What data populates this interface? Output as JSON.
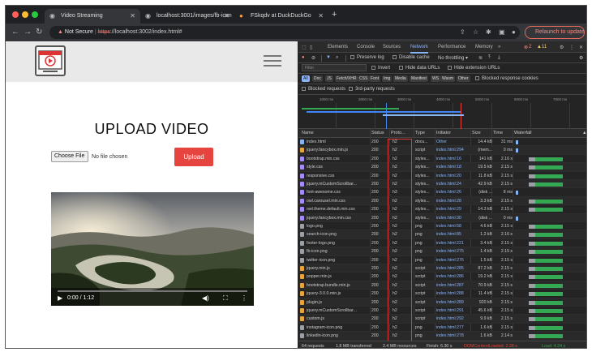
{
  "browser": {
    "tabs": [
      {
        "title": "Video Streaming",
        "active": true
      },
      {
        "title": "localhost:3001/images/fb-icon",
        "active": false
      },
      {
        "title": "FSkqdv at DuckDuckGo",
        "active": false
      }
    ],
    "address": {
      "warning": "Not Secure",
      "scheme": "https",
      "url_rest": "://localhost:3002/index.html#"
    },
    "relaunch_label": "Relaunch to update",
    "colors": {
      "close": "#ff5f57",
      "minimize": "#febc2e",
      "maximize": "#28c840"
    }
  },
  "page": {
    "heading": "UPLOAD VIDEO",
    "choose_file": "Choose File",
    "no_file": "No file chosen",
    "upload": "Upload",
    "video_time": "0:00 / 1:12"
  },
  "devtools": {
    "tabs": [
      "Elements",
      "Console",
      "Sources",
      "Network",
      "Performance",
      "Memory",
      "»"
    ],
    "active_tab": "Network",
    "errors": "2",
    "warnings": "11",
    "toolbar": {
      "preserve_log": "Preserve log",
      "disable_cache": "Disable cache",
      "throttling": "No throttling"
    },
    "filter": {
      "placeholder": "Filter",
      "invert": "Invert",
      "hide_data_urls": "Hide data URLs",
      "hide_ext_urls": "Hide extension URLs"
    },
    "types": [
      "All",
      "Doc",
      "JS",
      "Fetch/XHR",
      "CSS",
      "Font",
      "Img",
      "Media",
      "Manifest",
      "WS",
      "Wasm",
      "Other"
    ],
    "blocked_cookies": "Blocked response cookies",
    "blocked_requests": "Blocked requests",
    "third_party": "3rd-party requests",
    "timeline_ticks": [
      "1000 ms",
      "2000 ms",
      "3000 ms",
      "4000 ms",
      "5000 ms",
      "6000 ms",
      "7000 ms"
    ],
    "columns": [
      "Name",
      "Status",
      "Proto...",
      "Type",
      "Initiator",
      "Size",
      "Time",
      "Waterfall"
    ],
    "requests": [
      {
        "name": "index.html",
        "status": "200",
        "proto": "h2",
        "type": "docu...",
        "initiator": "Other",
        "size": "14.4 kB",
        "time": "31 ms",
        "kind": "doc"
      },
      {
        "name": "jquery.fancybox.min.js",
        "status": "200",
        "proto": "h2",
        "type": "script",
        "initiator": "index.html:294",
        "size": "(mem...",
        "time": "0 ms",
        "kind": "js"
      },
      {
        "name": "bootstrap.min.css",
        "status": "200",
        "proto": "h2",
        "type": "styles...",
        "initiator": "index.html:16",
        "size": "141 kB",
        "time": "2.16 s",
        "kind": "css"
      },
      {
        "name": "style.css",
        "status": "200",
        "proto": "h2",
        "type": "styles...",
        "initiator": "index.html:18",
        "size": "19.5 kB",
        "time": "2.15 s",
        "kind": "css"
      },
      {
        "name": "responsive.css",
        "status": "200",
        "proto": "h2",
        "type": "styles...",
        "initiator": "index.html:20",
        "size": "11.8 kB",
        "time": "2.15 s",
        "kind": "css"
      },
      {
        "name": "jquery.mCustomScrollbar...",
        "status": "200",
        "proto": "h2",
        "type": "styles...",
        "initiator": "index.html:24",
        "size": "42.9 kB",
        "time": "2.15 s",
        "kind": "css"
      },
      {
        "name": "font-awesome.css",
        "status": "200",
        "proto": "h3",
        "type": "styles...",
        "initiator": "index.html:26",
        "size": "(disk ...",
        "time": "8 ms",
        "kind": "css"
      },
      {
        "name": "owl.carousel.min.css",
        "status": "200",
        "proto": "h2",
        "type": "styles...",
        "initiator": "index.html:28",
        "size": "3.3 kB",
        "time": "2.15 s",
        "kind": "css"
      },
      {
        "name": "owl.theme.default.min.css",
        "status": "200",
        "proto": "h2",
        "type": "styles...",
        "initiator": "index.html:29",
        "size": "14.3 kB",
        "time": "2.15 s",
        "kind": "css"
      },
      {
        "name": "jquery.fancybox.min.css",
        "status": "200",
        "proto": "h2",
        "type": "styles...",
        "initiator": "index.html:30",
        "size": "(disk ...",
        "time": "0 ms",
        "kind": "css"
      },
      {
        "name": "logo.png",
        "status": "200",
        "proto": "h2",
        "type": "png",
        "initiator": "index.html:58",
        "size": "4.6 kB",
        "time": "2.15 s",
        "kind": "img"
      },
      {
        "name": "search-icon.png",
        "status": "200",
        "proto": "h2",
        "type": "png",
        "initiator": "index.html:85",
        "size": "1.2 kB",
        "time": "2.16 s",
        "kind": "img"
      },
      {
        "name": "footer-logo.png",
        "status": "200",
        "proto": "h2",
        "type": "png",
        "initiator": "index.html:221",
        "size": "3.4 kB",
        "time": "2.15 s",
        "kind": "img"
      },
      {
        "name": "fb-icon.png",
        "status": "200",
        "proto": "h2",
        "type": "png",
        "initiator": "index.html:275",
        "size": "1.4 kB",
        "time": "2.15 s",
        "kind": "img"
      },
      {
        "name": "twitter-icon.png",
        "status": "200",
        "proto": "h2",
        "type": "png",
        "initiator": "index.html:276",
        "size": "1.5 kB",
        "time": "2.15 s",
        "kind": "img"
      },
      {
        "name": "jquery.min.js",
        "status": "200",
        "proto": "h2",
        "type": "script",
        "initiator": "index.html:285",
        "size": "87.2 kB",
        "time": "2.15 s",
        "kind": "js"
      },
      {
        "name": "popper.min.js",
        "status": "200",
        "proto": "h2",
        "type": "script",
        "initiator": "index.html:286",
        "size": "19.2 kB",
        "time": "2.15 s",
        "kind": "js"
      },
      {
        "name": "bootstrap.bundle.min.js",
        "status": "200",
        "proto": "h2",
        "type": "script",
        "initiator": "index.html:287",
        "size": "70.9 kB",
        "time": "2.15 s",
        "kind": "js"
      },
      {
        "name": "jquery-3.0.0.min.js",
        "status": "200",
        "proto": "h2",
        "type": "script",
        "initiator": "index.html:288",
        "size": "11.4 kB",
        "time": "2.15 s",
        "kind": "js"
      },
      {
        "name": "plugin.js",
        "status": "200",
        "proto": "h2",
        "type": "script",
        "initiator": "index.html:289",
        "size": "920 kB",
        "time": "2.15 s",
        "kind": "js"
      },
      {
        "name": "jquery.mCustomScrollbar...",
        "status": "200",
        "proto": "h2",
        "type": "script",
        "initiator": "index.html:291",
        "size": "45.6 kB",
        "time": "2.15 s",
        "kind": "js"
      },
      {
        "name": "custom.js",
        "status": "200",
        "proto": "h2",
        "type": "script",
        "initiator": "index.html:292",
        "size": "9.9 kB",
        "time": "2.15 s",
        "kind": "js"
      },
      {
        "name": "instagram-icon.png",
        "status": "200",
        "proto": "h2",
        "type": "png",
        "initiator": "index.html:277",
        "size": "1.6 kB",
        "time": "2.15 s",
        "kind": "img"
      },
      {
        "name": "linkedin-icon.png",
        "status": "200",
        "proto": "h2",
        "type": "png",
        "initiator": "index.html:278",
        "size": "1.6 kB",
        "time": "2.14 s",
        "kind": "img"
      }
    ],
    "status": {
      "requests": "64 requests",
      "transferred": "1.8 MB transferred",
      "resources": "2.4 MB resources",
      "finish": "Finish: 6.30 s",
      "dcl": "DOMContentLoaded: 2.28 s",
      "load": "Load: 4.24 s"
    },
    "colors": {
      "doc": "#8ab4f8",
      "js": "#e8a33d",
      "css": "#a78bfa",
      "img": "#9aa0a6",
      "waterfall": "#34a853",
      "dcl": "#4285f4",
      "load": "#ea4335",
      "highlight": "#e03a3a"
    }
  }
}
